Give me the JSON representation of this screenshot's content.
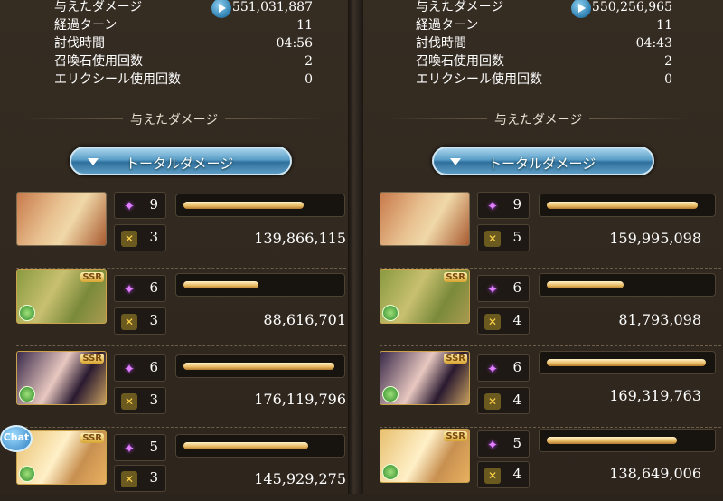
{
  "left": {
    "stats": [
      {
        "label": "与えたダメージ",
        "value": "551,031,887"
      },
      {
        "label": "経過ターン",
        "value": "11"
      },
      {
        "label": "討伐時間",
        "value": "04:56"
      },
      {
        "label": "召喚石使用回数",
        "value": "2"
      },
      {
        "label": "エリクシール使用回数",
        "value": "0"
      }
    ],
    "section_title": "与えたダメージ",
    "dropdown_label": "トータルダメージ",
    "characters": [
      {
        "ougi": "9",
        "skill": "3",
        "damage": "139,866,115",
        "bar": 0.78,
        "ssr": false
      },
      {
        "ougi": "6",
        "skill": "3",
        "damage": "88,616,701",
        "bar": 0.49,
        "ssr": true
      },
      {
        "ougi": "6",
        "skill": "3",
        "damage": "176,119,796",
        "bar": 0.98,
        "ssr": true
      },
      {
        "ougi": "5",
        "skill": "3",
        "damage": "145,929,275",
        "bar": 0.81,
        "ssr": true
      }
    ]
  },
  "right": {
    "stats": [
      {
        "label": "与えたダメージ",
        "value": "550,256,965"
      },
      {
        "label": "経過ターン",
        "value": "11"
      },
      {
        "label": "討伐時間",
        "value": "04:43"
      },
      {
        "label": "召喚石使用回数",
        "value": "2"
      },
      {
        "label": "エリクシール使用回数",
        "value": "0"
      }
    ],
    "section_title": "与えたダメージ",
    "dropdown_label": "トータルダメージ",
    "characters": [
      {
        "ougi": "9",
        "skill": "5",
        "damage": "159,995,098",
        "bar": 0.94,
        "ssr": false
      },
      {
        "ougi": "6",
        "skill": "4",
        "damage": "81,793,098",
        "bar": 0.48,
        "ssr": true
      },
      {
        "ougi": "6",
        "skill": "4",
        "damage": "169,319,763",
        "bar": 0.99,
        "ssr": true
      },
      {
        "ougi": "5",
        "skill": "4",
        "damage": "138,649,006",
        "bar": 0.81,
        "ssr": true
      }
    ]
  },
  "chat_label": "Chat",
  "icons": {
    "play": "play-icon",
    "ougi": "sparkle-icon",
    "skill": "skill-icon",
    "element": "wind-element-icon",
    "dropdown": "chevron-down-icon"
  }
}
